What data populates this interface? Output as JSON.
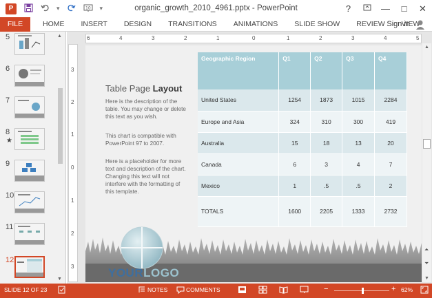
{
  "window": {
    "title": "organic_growth_2010_4961.pptx - PowerPoint",
    "app_icon_label": "P",
    "help": "?",
    "restore": "□",
    "minimize": "—",
    "maximize": "□",
    "close": "✕",
    "sign_in": "Sign in"
  },
  "ribbon": {
    "tabs": [
      "FILE",
      "HOME",
      "INSERT",
      "DESIGN",
      "TRANSITIONS",
      "ANIMATIONS",
      "SLIDE SHOW",
      "REVIEW",
      "VIEW"
    ]
  },
  "ruler": {
    "h_labels": [
      "6",
      "5",
      "4",
      "3",
      "2",
      "1",
      "0",
      "1",
      "2",
      "3",
      "4",
      "5",
      "6"
    ],
    "v_labels": [
      "3",
      "2",
      "1",
      "0",
      "1",
      "2",
      "3"
    ]
  },
  "thumbnails": [
    {
      "num": "5",
      "star": ""
    },
    {
      "num": "6",
      "star": ""
    },
    {
      "num": "7",
      "star": ""
    },
    {
      "num": "8",
      "star": "★"
    },
    {
      "num": "9",
      "star": ""
    },
    {
      "num": "10",
      "star": ""
    },
    {
      "num": "11",
      "star": ""
    },
    {
      "num": "12",
      "star": ""
    }
  ],
  "selected_slide": 12,
  "slide": {
    "title_light": "Table Page ",
    "title_bold": "Layout",
    "desc1": "Here is the description of the table.  You may change or delete this text as you wish.",
    "desc2": "This chart is compatible with PowerPoint 97 to 2007.",
    "desc3": "Here is a placeholder for more text and description of the chart.  Changing this text will not interfere with the formatting of this template.",
    "logo_part1": "YOUR",
    "logo_part2": "LOGO",
    "table": {
      "headers": [
        "Geographic Region",
        "Q1",
        "Q2",
        "Q3",
        "Q4"
      ],
      "rows": [
        [
          "United States",
          "1254",
          "1873",
          "1015",
          "2284"
        ],
        [
          "Europe and Asia",
          "324",
          "310",
          "300",
          "419"
        ],
        [
          "Australia",
          "15",
          "18",
          "13",
          "20"
        ],
        [
          "Canada",
          "6",
          "3",
          "4",
          "7"
        ],
        [
          "Mexico",
          "1",
          ".5",
          ".5",
          "2"
        ]
      ],
      "totals": [
        "TOTALS",
        "1600",
        "2205",
        "1333",
        "2732"
      ]
    }
  },
  "status": {
    "slide_info": "SLIDE 12 OF 23",
    "notes": "NOTES",
    "comments": "COMMENTS",
    "zoom": "62%",
    "zoom_out": "−",
    "zoom_in": "+"
  },
  "colors": {
    "accent": "#d24726",
    "table_header": "#a8cfd8",
    "logo_blue": "#3d6fa0",
    "logo_light": "#9cc3cf"
  }
}
